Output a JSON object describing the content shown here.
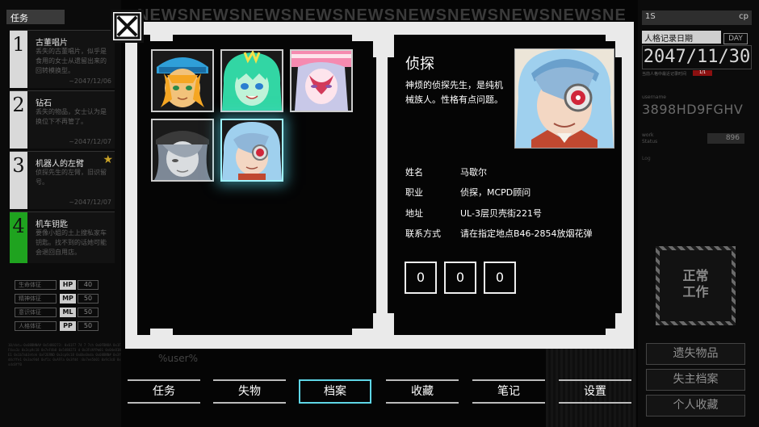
{
  "left_sidebar": {
    "header": "任务",
    "tasks": [
      {
        "num": "1",
        "title": "古董唱片",
        "desc": "丢失的古董唱片，似乎是食用的女士从遗留出来的回转模换型。",
        "date": "~2047/12/06"
      },
      {
        "num": "2",
        "title": "钻石",
        "desc": "丢失的物品，女士认为是换位下不再管了。",
        "date": "~2047/12/07"
      },
      {
        "num": "3",
        "title": "机器人的左臂",
        "desc": "侦探先生的左臂，旧识留号。",
        "date": "~2047/12/07"
      },
      {
        "num": "4",
        "title": "机车钥匙",
        "desc": "要像小姐的土上搜私家车钥匙。找不到的话她可能会退回自用店。",
        "date": ""
      }
    ],
    "stats": [
      {
        "label": "生命体征",
        "key": "HP",
        "value": "40"
      },
      {
        "label": "精神体征",
        "key": "MP",
        "value": "50"
      },
      {
        "label": "意识体征",
        "key": "ML",
        "value": "50"
      },
      {
        "label": "人格体征",
        "key": "PP",
        "value": "50"
      }
    ],
    "noise": "10/dot=-0x08BNNA#  0x5488273:  0x61F7 74 7 7ch 0x0FBNOA  0x1FF4xx3z 0x3cp9c18 0x7eF4b8 0x5488273  d 0x3FcNfPm01 0x04e81NE1  0x1b7ab3ntok 0xF2ERND 0x3cp9c18  0x0bs0nda 0x08BNN#  0x3fd4cffe1  0x3ac9d4 0xf1c 0xAFFa  0x3fd4 :0x7ee5b01 0x9c3c0 0xsdc0ff0"
  },
  "right_sidebar": {
    "top_left": "1S",
    "top_right": "cp",
    "record_label": "人格记录日期",
    "day_badge": "DAY",
    "date": "2047/11/30",
    "small_note": "当前人格中最近记录时间",
    "red_tag": "1/1",
    "username_label": "username",
    "username": "3898HD9FGHV",
    "count_label": "work\nStatus",
    "count": "896",
    "log_label": "Log",
    "status": "正常\n工作",
    "buttons": [
      "遗失物品",
      "失主档案",
      "个人收藏"
    ]
  },
  "news_ticker": "NEWSNEWSNEWSNEWSNEWSNEWSNEWSNEWSNEWSNEWSNEWSNEWS",
  "under_text": "%user%",
  "tabs": [
    {
      "label": "任务",
      "active": false
    },
    {
      "label": "失物",
      "active": false
    },
    {
      "label": "档案",
      "active": true
    },
    {
      "label": "收藏",
      "active": false
    },
    {
      "label": "笔记",
      "active": false
    },
    {
      "label": "设置",
      "active": false
    }
  ],
  "dossier": {
    "characters": [
      {
        "name": "character-1-avatar",
        "skin": "#f2c27a",
        "hair": "#f5a623",
        "hat": "#2f9fd8",
        "selected": false
      },
      {
        "name": "character-2-avatar",
        "skin": "#bff3d8",
        "hair": "#32d6a4",
        "hat": "#f5e04a",
        "selected": false
      },
      {
        "name": "character-3-avatar",
        "skin": "#fde4ec",
        "hair": "#f58ab0",
        "hat": "#c8c8e8",
        "selected": false
      },
      {
        "name": "character-4-avatar",
        "skin": "#d9dcdf",
        "hair": "#7d8896",
        "hat": "#3a3a3a",
        "selected": false
      },
      {
        "name": "character-5-avatar",
        "skin": "#f3d7c3",
        "hair": "#9fd0ee",
        "hat": "#8fb6d8",
        "selected": true
      }
    ],
    "selected": {
      "name": "侦探",
      "description": "神烦的侦探先生，是纯机械族人。性格有点问题。",
      "fields": [
        {
          "key": "姓名",
          "value": "马歇尔"
        },
        {
          "key": "职业",
          "value": "侦探，MCPD顾问"
        },
        {
          "key": "地址",
          "value": "UL-3层贝壳街221号"
        },
        {
          "key": "联系方式",
          "value": "请在指定地点B46-2854放烟花弹"
        }
      ],
      "counters": [
        "0",
        "0",
        "0"
      ]
    }
  }
}
